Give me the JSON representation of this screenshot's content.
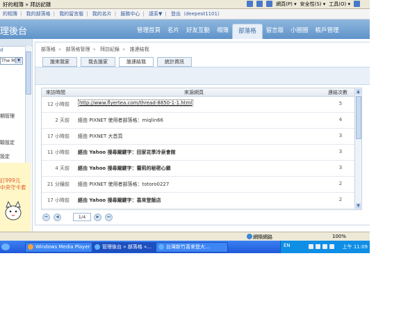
{
  "browser": {
    "page_title": "好的相簿 » 拜訪記錄",
    "tools": [
      "網頁(P) ▾",
      "安全性(S) ▾",
      "工具(O) ▾"
    ]
  },
  "topnav": [
    "的相簿",
    "我的部落格",
    "我的留言版",
    "我的名片",
    "服務中心",
    "語系▼",
    "登出（deepest1101）"
  ],
  "banner": {
    "brand": "理後台",
    "tabs": [
      "管理首頁",
      "名片",
      "好友互動",
      "相簿",
      "部落格",
      "留言版",
      "小圈圈",
      "帳戶管理"
    ],
    "active_tab": "部落格"
  },
  "leftcol": {
    "label": "d",
    "select_value": "The M",
    "items": [
      "期管理",
      "驗設定",
      "設定"
    ],
    "ad_text": "訂999元",
    "ad_text2": "中央守卡套"
  },
  "breadcrumb": [
    "部落格",
    "部落格管理",
    "拜訪紀錄",
    "誰連結我"
  ],
  "subtabs": [
    "誰來我家",
    "我去誰家",
    "誰連結我",
    "統計資訊"
  ],
  "active_subtab": "誰連結我",
  "table": {
    "headers": {
      "time": "來訪時間",
      "source": "來源網頁",
      "count": "連結次數"
    },
    "rows": [
      {
        "time": "12 小時前",
        "source": "http://www.flyertea.com/thread-8850-1-1.html",
        "count": "5"
      },
      {
        "time": "2 天前",
        "source": "經由 PIXNET 使用者部落格：miqlin66",
        "count": "4"
      },
      {
        "time": "17 小時前",
        "source": "經由 PIXNET 大首頁",
        "count": "3"
      },
      {
        "time": "11 小時前",
        "source": "經由 Yahoo 搜尋關鍵字：田家花季冷泉會館",
        "count": "3"
      },
      {
        "time": "4 天前",
        "source": "經由 Yahoo 搜尋關鍵字：蕾莉的秘密心鎖",
        "count": "3"
      },
      {
        "time": "21 分鐘前",
        "source": "經由 PIXNET 使用者部落格：totoro0227",
        "count": "2"
      },
      {
        "time": "17 小時前",
        "source": "經由 Yahoo 搜尋關鍵字：喜來登飯店",
        "count": "2"
      }
    ]
  },
  "pager": {
    "page": "1/4"
  },
  "status": {
    "zone": "網際網路",
    "zoom": "100%"
  },
  "taskbar": {
    "tasks": [
      "Windows Media Player",
      "管理後台 » 部落格 »...",
      "台灣新竹喜來登大..."
    ],
    "clock": "上午 11:09",
    "lang": "EN"
  }
}
